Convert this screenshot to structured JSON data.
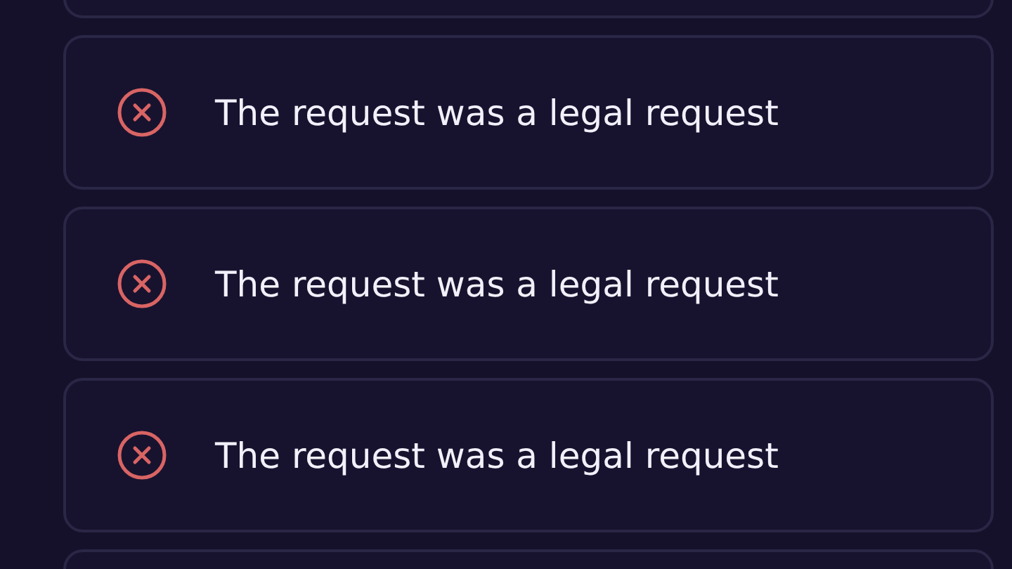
{
  "toasts": [
    {
      "kind": "blank"
    },
    {
      "kind": "error",
      "message": "The request was a legal request"
    },
    {
      "kind": "error",
      "message": "The request was a legal request"
    },
    {
      "kind": "error",
      "message": "The request was a legal request"
    },
    {
      "kind": "blank"
    }
  ]
}
